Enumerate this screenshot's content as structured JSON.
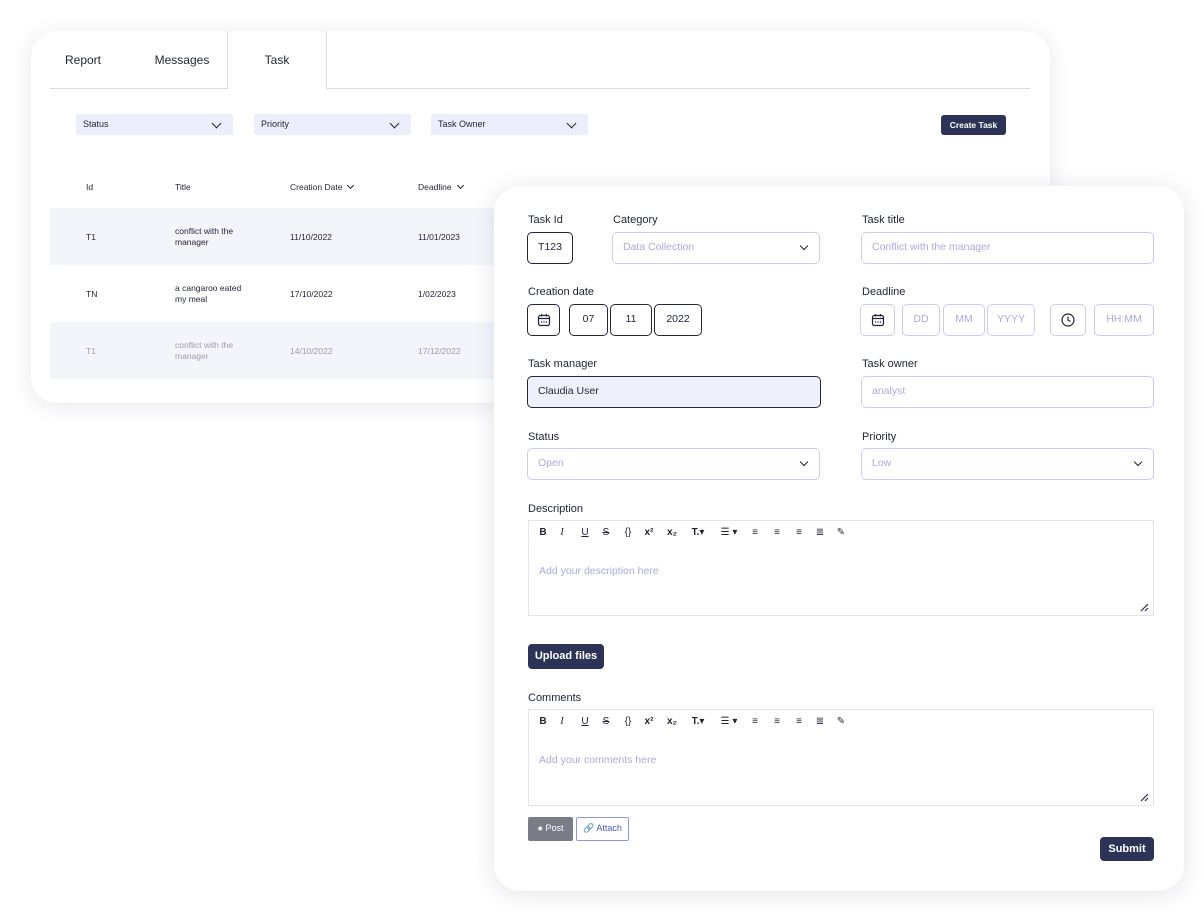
{
  "tabs": [
    "Report",
    "Messages",
    "Task"
  ],
  "filters": {
    "status": "Status",
    "priority": "Priority",
    "owner": "Task Owner"
  },
  "create_button": "Create Task",
  "table": {
    "headers": [
      "Id",
      "Title",
      "Creation Date",
      "Deadline"
    ],
    "rows": [
      {
        "id": "T1",
        "title_1": "conflict with the",
        "title_2": "manager",
        "created": "11/10/2022",
        "deadline": "11/01/2023"
      },
      {
        "id": "TN",
        "title_1": "a cangaroo eated",
        "title_2": "my meal",
        "created": "17/10/2022",
        "deadline": "1/02/2023"
      },
      {
        "id": "T1",
        "title_1": "conflict with the",
        "title_2": "manager",
        "created": "14/10/2022",
        "deadline": "17/12/2022"
      }
    ]
  },
  "form": {
    "task_id": {
      "label": "Task Id",
      "value": "T123"
    },
    "category": {
      "label": "Category",
      "value": "Data Collection"
    },
    "task_title": {
      "label": "Task title",
      "placeholder": "Conflict with the manager"
    },
    "creation_date": {
      "label": "Creation date",
      "day": "07",
      "month": "11",
      "year": "2022"
    },
    "deadline": {
      "label": "Deadline",
      "day": "DD",
      "month": "MM",
      "year": "YYYY",
      "time": "HH:MM"
    },
    "task_manager": {
      "label": "Task manager",
      "value": "Claudia User"
    },
    "task_owner": {
      "label": "Task owner",
      "placeholder": "analyst"
    },
    "status": {
      "label": "Status",
      "value": "Open"
    },
    "priority": {
      "label": "Priority",
      "value": "Low"
    },
    "description": {
      "label": "Description",
      "placeholder": "Add your description here"
    },
    "upload": "Upload files",
    "comments": {
      "label": "Comments",
      "placeholder": "Add your comments here"
    },
    "post": "Post",
    "attach": "Attach",
    "submit": "Submit"
  },
  "toolbar_icons": [
    "bold-icon",
    "italic-icon",
    "underline-icon",
    "strikethrough-icon",
    "code-icon",
    "superscript-icon",
    "subscript-icon",
    "text-size-icon",
    "list-icon",
    "align-left-icon",
    "align-center-icon",
    "align-right-icon",
    "align-justify-icon",
    "pen-icon"
  ],
  "colors": {
    "primary": "#2c3356",
    "input_border": "#c9cdf1",
    "placeholder": "#a9acd9",
    "filter_bg": "#eceefb"
  }
}
